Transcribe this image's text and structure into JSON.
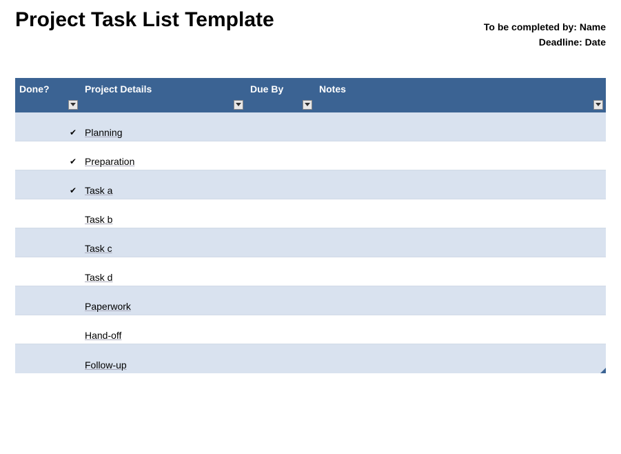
{
  "header": {
    "title": "Project Task List Template",
    "completed_by_label": "To be completed by:",
    "completed_by_value": "Name",
    "deadline_label": "Deadline:",
    "deadline_value": "Date"
  },
  "table": {
    "columns": {
      "done": "Done?",
      "details": "Project Details",
      "due": "Due By",
      "notes": "Notes"
    },
    "rows": [
      {
        "done": true,
        "details": "Planning",
        "due": "",
        "notes": ""
      },
      {
        "done": true,
        "details": "Preparation",
        "due": "",
        "notes": ""
      },
      {
        "done": true,
        "details": "Task a",
        "due": "",
        "notes": ""
      },
      {
        "done": false,
        "details": "Task b",
        "due": "",
        "notes": ""
      },
      {
        "done": false,
        "details": "Task c",
        "due": "",
        "notes": ""
      },
      {
        "done": false,
        "details": "Task d",
        "due": "",
        "notes": ""
      },
      {
        "done": false,
        "details": "Paperwork",
        "due": "",
        "notes": ""
      },
      {
        "done": false,
        "details": "Hand-off",
        "due": "",
        "notes": ""
      },
      {
        "done": false,
        "details": "Follow-up",
        "due": "",
        "notes": ""
      }
    ]
  }
}
